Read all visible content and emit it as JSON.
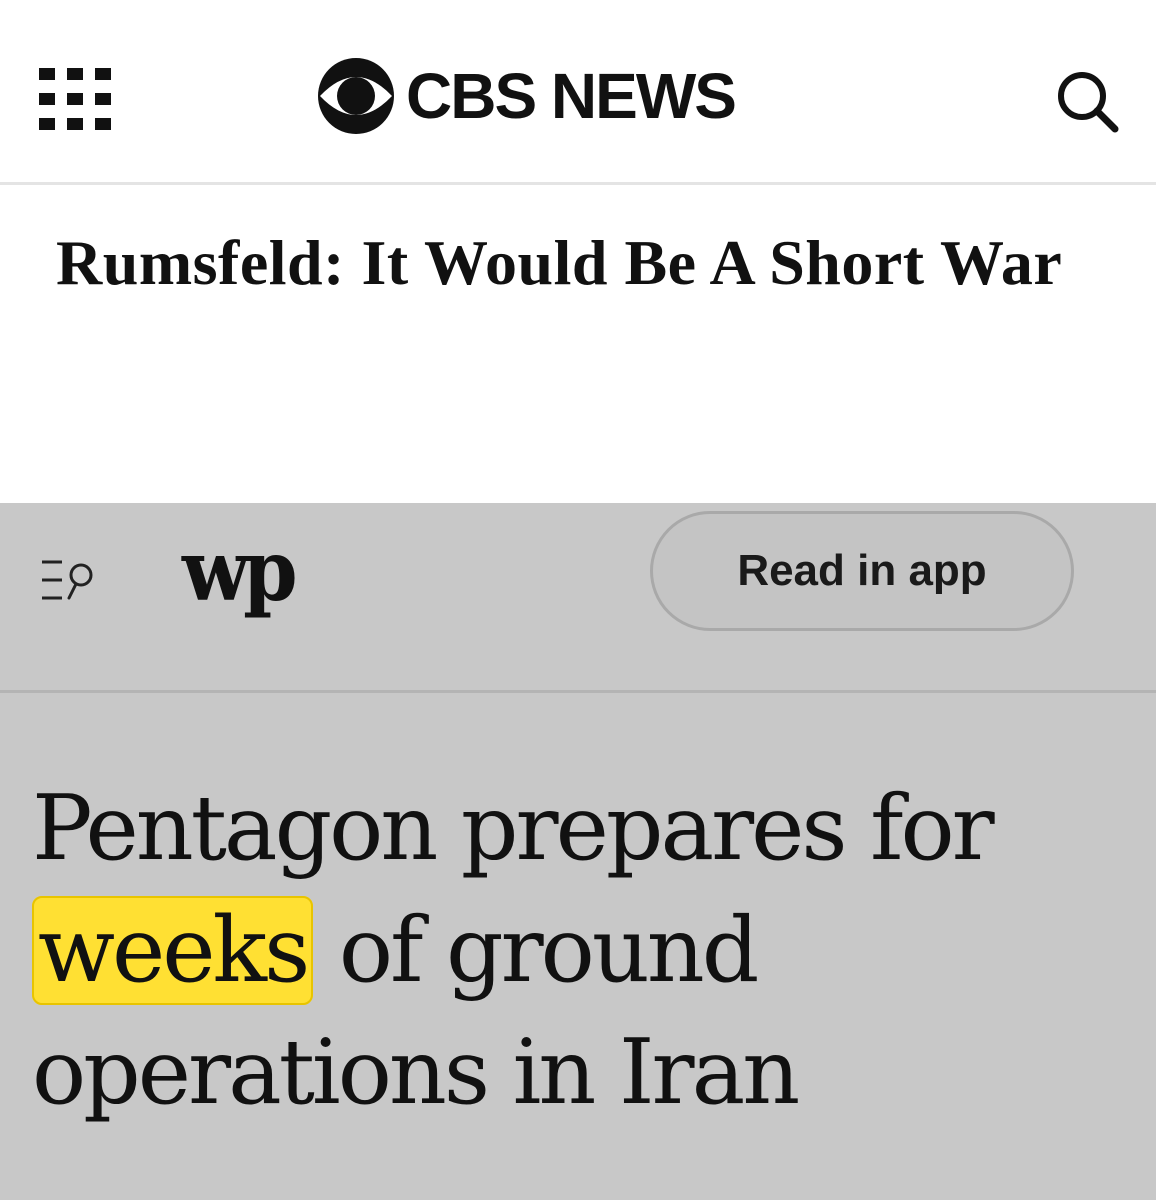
{
  "cbs": {
    "logo_text": "CBS NEWS",
    "headline": "Rumsfeld: It Would Be A Short War",
    "icons": {
      "menu": "grid-menu-icon",
      "search": "search-icon"
    }
  },
  "wapo": {
    "logo_text": "wp",
    "read_in_app_label": "Read in app",
    "headline": {
      "before": "Pentagon prepares for ",
      "highlighted": "weeks",
      "after": " of ground operations in Iran"
    },
    "highlight_color": "#ffe033",
    "icons": {
      "menu": "menu-search-icon"
    }
  }
}
